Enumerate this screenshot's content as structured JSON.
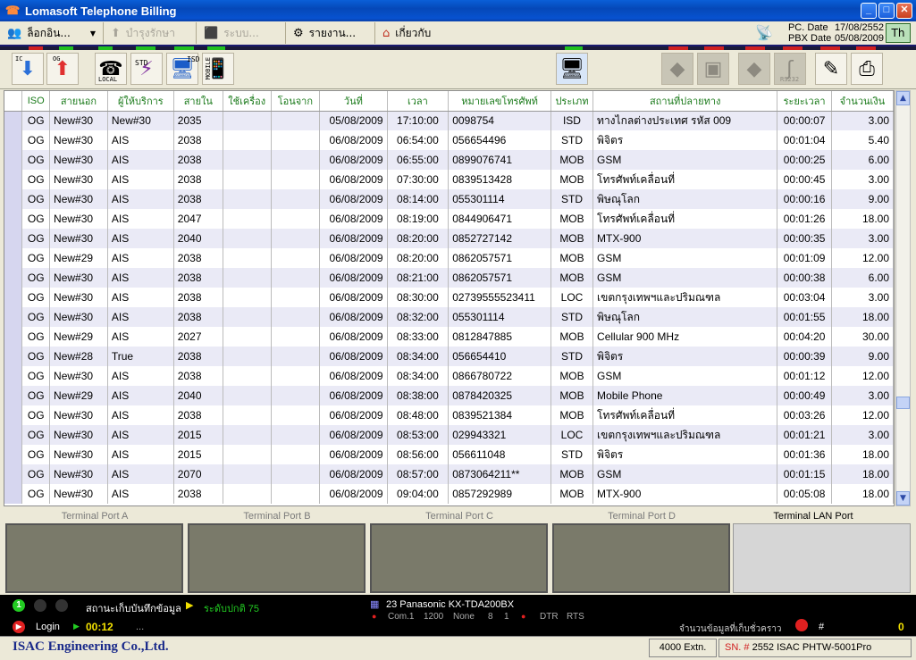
{
  "window": {
    "title": "Lomasoft Telephone Billing",
    "min": "_",
    "max": "□",
    "close": "✕"
  },
  "menu": {
    "login": "ล็อกอิน...",
    "maintain": "บำรุงรักษา",
    "system": "ระบบ...",
    "report": "รายงาน...",
    "about": "เกี่ยวกับ"
  },
  "dates": {
    "pc_label": "PC. Date",
    "pc_value": "17/08/2552",
    "pbx_label": "PBX Date",
    "pbx_value": "05/08/2009"
  },
  "lang_button": "Th",
  "toolbar": {
    "ic": "IC",
    "og": "OG",
    "local": "LOCAL",
    "std": "STD",
    "isd": "ISD",
    "mobile": "MOBILE",
    "rs232": "RS232"
  },
  "columns": [
    "ISO",
    "สายนอก",
    "ผู้ให้บริการ",
    "สายใน",
    "ใช้เครื่อง",
    "โอนจาก",
    "วันที่",
    "เวลา",
    "หมายเลขโทรศัพท์",
    "ประเภท",
    "สถานที่ปลายทาง",
    "ระยะเวลา",
    "จำนวนเงิน"
  ],
  "rows": [
    [
      "OG",
      "New#30",
      "New#30",
      "2035",
      "",
      "",
      "05/08/2009",
      "17:10:00",
      "0098754",
      "ISD",
      "ทางไกลต่างประเทศ รหัส 009",
      "00:00:07",
      "3.00"
    ],
    [
      "OG",
      "New#30",
      "AIS",
      "2038",
      "",
      "",
      "06/08/2009",
      "06:54:00",
      "056654496",
      "STD",
      "พิจิตร",
      "00:01:04",
      "5.40"
    ],
    [
      "OG",
      "New#30",
      "AIS",
      "2038",
      "",
      "",
      "06/08/2009",
      "06:55:00",
      "0899076741",
      "MOB",
      "GSM",
      "00:00:25",
      "6.00"
    ],
    [
      "OG",
      "New#30",
      "AIS",
      "2038",
      "",
      "",
      "06/08/2009",
      "07:30:00",
      "0839513428",
      "MOB",
      "โทรศัพท์เคลื่อนที่",
      "00:00:45",
      "3.00"
    ],
    [
      "OG",
      "New#30",
      "AIS",
      "2038",
      "",
      "",
      "06/08/2009",
      "08:14:00",
      "055301114",
      "STD",
      "พิษณุโลก",
      "00:00:16",
      "9.00"
    ],
    [
      "OG",
      "New#30",
      "AIS",
      "2047",
      "",
      "",
      "06/08/2009",
      "08:19:00",
      "0844906471",
      "MOB",
      "โทรศัพท์เคลื่อนที่",
      "00:01:26",
      "18.00"
    ],
    [
      "OG",
      "New#30",
      "AIS",
      "2040",
      "",
      "",
      "06/08/2009",
      "08:20:00",
      "0852727142",
      "MOB",
      "MTX-900",
      "00:00:35",
      "3.00"
    ],
    [
      "OG",
      "New#29",
      "AIS",
      "2038",
      "",
      "",
      "06/08/2009",
      "08:20:00",
      "0862057571",
      "MOB",
      "GSM",
      "00:01:09",
      "12.00"
    ],
    [
      "OG",
      "New#30",
      "AIS",
      "2038",
      "",
      "",
      "06/08/2009",
      "08:21:00",
      "0862057571",
      "MOB",
      "GSM",
      "00:00:38",
      "6.00"
    ],
    [
      "OG",
      "New#30",
      "AIS",
      "2038",
      "",
      "",
      "06/08/2009",
      "08:30:00",
      "02739555523411",
      "LOC",
      "เขตกรุงเทพฯและปริมณฑล",
      "00:03:04",
      "3.00"
    ],
    [
      "OG",
      "New#30",
      "AIS",
      "2038",
      "",
      "",
      "06/08/2009",
      "08:32:00",
      "055301114",
      "STD",
      "พิษณุโลก",
      "00:01:55",
      "18.00"
    ],
    [
      "OG",
      "New#29",
      "AIS",
      "2027",
      "",
      "",
      "06/08/2009",
      "08:33:00",
      "0812847885",
      "MOB",
      "Cellular 900 MHz",
      "00:04:20",
      "30.00"
    ],
    [
      "OG",
      "New#28",
      "True",
      "2038",
      "",
      "",
      "06/08/2009",
      "08:34:00",
      "056654410",
      "STD",
      "พิจิตร",
      "00:00:39",
      "9.00"
    ],
    [
      "OG",
      "New#30",
      "AIS",
      "2038",
      "",
      "",
      "06/08/2009",
      "08:34:00",
      "0866780722",
      "MOB",
      "GSM",
      "00:01:12",
      "12.00"
    ],
    [
      "OG",
      "New#29",
      "AIS",
      "2040",
      "",
      "",
      "06/08/2009",
      "08:38:00",
      "0878420325",
      "MOB",
      "Mobile Phone",
      "00:00:49",
      "3.00"
    ],
    [
      "OG",
      "New#30",
      "AIS",
      "2038",
      "",
      "",
      "06/08/2009",
      "08:48:00",
      "0839521384",
      "MOB",
      "โทรศัพท์เคลื่อนที่",
      "00:03:26",
      "12.00"
    ],
    [
      "OG",
      "New#30",
      "AIS",
      "2015",
      "",
      "",
      "06/08/2009",
      "08:53:00",
      "029943321",
      "LOC",
      "เขตกรุงเทพฯและปริมณฑล",
      "00:01:21",
      "3.00"
    ],
    [
      "OG",
      "New#30",
      "AIS",
      "2015",
      "",
      "",
      "06/08/2009",
      "08:56:00",
      "056611048",
      "STD",
      "พิจิตร",
      "00:01:36",
      "18.00"
    ],
    [
      "OG",
      "New#30",
      "AIS",
      "2070",
      "",
      "",
      "06/08/2009",
      "08:57:00",
      "0873064211**",
      "MOB",
      "GSM",
      "00:01:15",
      "18.00"
    ],
    [
      "OG",
      "New#30",
      "AIS",
      "2038",
      "",
      "",
      "06/08/2009",
      "09:04:00",
      "0857292989",
      "MOB",
      "MTX-900",
      "00:05:08",
      "18.00"
    ]
  ],
  "ports": [
    "Terminal Port A",
    "Terminal Port B",
    "Terminal Port C",
    "Terminal Port D",
    "Terminal LAN Port"
  ],
  "status": {
    "dot1": "1",
    "store_label": "สถานะเก็บบันทึกข้อมูล",
    "store_value": "ระดับปกติ 75",
    "login": "Login",
    "time": "00:12",
    "dots": "...",
    "pbx_model": "23 Panasonic KX-TDA200BX",
    "com": "Com.1",
    "baud": "1200",
    "parity": "None",
    "bits": "8",
    "stop": "1",
    "dtr": "DTR",
    "rts": "RTS",
    "temp_label": "จำนวนข้อมูลที่เก็บชั่วคราว",
    "hash": "#",
    "count": "0"
  },
  "footer": {
    "company": "ISAC Engineering Co.,Ltd.",
    "extn": "4000 Extn.",
    "sn_label": "SN. #",
    "sn_value": "2552 ISAC PHTW-5001Pro"
  },
  "colors": {
    "title_blue": "#0548b8",
    "header_green": "#1a7a1a",
    "row_alt": "#eaeaf6",
    "status_green": "#22cc22",
    "status_yellow": "#f2e000"
  }
}
